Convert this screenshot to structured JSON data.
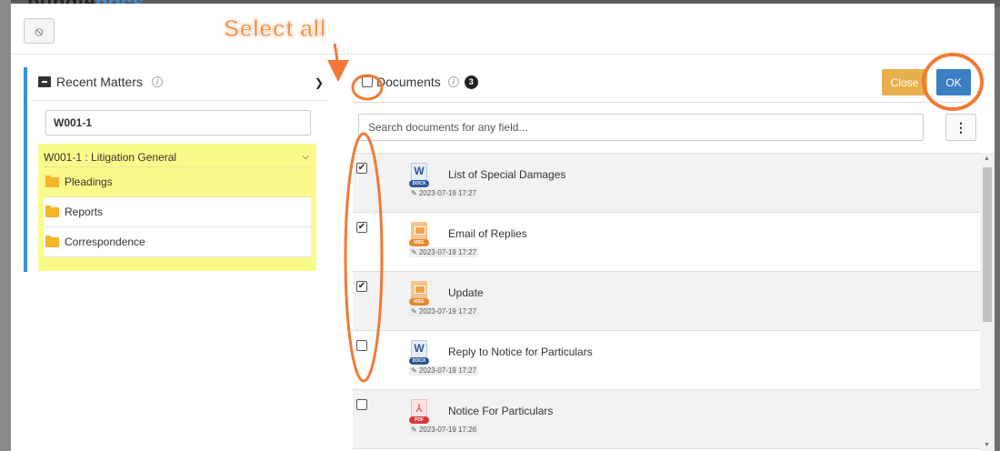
{
  "backdrop": {
    "brand_part1": "bundle",
    "brand_part2": "docs"
  },
  "toolbar": {
    "icon": "no-sync-icon"
  },
  "matters_panel": {
    "title": "Recent Matters",
    "info_icon": "ⓘ",
    "search_value": "W001-1",
    "tree": {
      "root_label": "W001-1 : Litigation General",
      "folders": [
        "Pleadings",
        "Reports",
        "Correspondence"
      ]
    }
  },
  "documents_panel": {
    "title": "Documents",
    "info_icon": "ⓘ",
    "count": "3",
    "close_label": "Close",
    "ok_label": "OK",
    "search_placeholder": "Search documents for any field...",
    "items": [
      {
        "title": "List of Special Damages",
        "type": "DOCX",
        "type_letter": "W",
        "date": "2023-07-19 17:27",
        "checked": true
      },
      {
        "title": "Email of Replies",
        "type": "MSG",
        "type_letter": "",
        "date": "2023-07-19 17:27",
        "checked": true
      },
      {
        "title": "Update",
        "type": "MSG",
        "type_letter": "",
        "date": "2023-07-19 17:27",
        "checked": true
      },
      {
        "title": "Reply to Notice for Particulars",
        "type": "DOCX",
        "type_letter": "W",
        "date": "2023-07-19 17:27",
        "checked": false
      },
      {
        "title": "Notice For Particulars",
        "type": "PDF",
        "type_letter": "⅄",
        "date": "2023-07-19 17:26",
        "checked": false
      }
    ]
  },
  "annotation": {
    "label": "Select all",
    "color": "#f07a35"
  }
}
